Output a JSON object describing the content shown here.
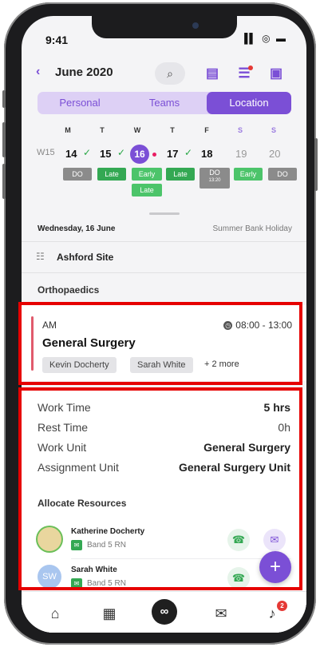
{
  "status_bar": {
    "time": "9:41",
    "icons": "▐▌ ◎ ▬"
  },
  "header": {
    "back_icon": "‹",
    "month": "June 2020",
    "search_icon": "⌕",
    "layout_icon": "▤",
    "filter_icon": "☰",
    "calendar_icon": "▣"
  },
  "segments": [
    "Personal",
    "Teams",
    "Location"
  ],
  "week": {
    "label": "W15",
    "day_letters": [
      "M",
      "T",
      "W",
      "T",
      "F",
      "S",
      "S"
    ],
    "days": [
      {
        "num": "14",
        "check": "✓",
        "shifts": [
          "DO"
        ]
      },
      {
        "num": "15",
        "check": "✓",
        "shifts": [
          "Late"
        ]
      },
      {
        "num": "16",
        "check": "",
        "shifts": [
          "Early",
          "Late"
        ]
      },
      {
        "num": "17",
        "check": "✓",
        "shifts": [
          "Late"
        ]
      },
      {
        "num": "18",
        "check": "",
        "shifts": [
          "DO",
          "13:20"
        ]
      },
      {
        "num": "19",
        "check": "",
        "shifts": [
          "Early"
        ]
      },
      {
        "num": "20",
        "check": "",
        "shifts": [
          "DO"
        ]
      }
    ]
  },
  "sheet": {
    "date": "Wednesday, 16 June",
    "holiday": "Summer Bank Holiday",
    "site_icon": "☷",
    "site": "Ashford Site",
    "department": "Orthopaedics"
  },
  "shift_card": {
    "period": "AM",
    "clock_icon": "◷",
    "time": "08:00 - 13:00",
    "title": "General Surgery",
    "people": [
      "Kevin Docherty",
      "Sarah White"
    ],
    "more": "+ 2 more"
  },
  "details": [
    {
      "label": "Work Time",
      "value": "5 hrs"
    },
    {
      "label": "Rest Time",
      "value": "0h"
    },
    {
      "label": "Work Unit",
      "value": "General Surgery"
    },
    {
      "label": "Assignment Unit",
      "value": "General Surgery Unit"
    }
  ],
  "allocate": {
    "title": "Allocate Resources",
    "resources": [
      {
        "name": "Katherine Docherty",
        "band": "Band 5 RN",
        "initials": ""
      },
      {
        "name": "Sarah White",
        "band": "Band 5 RN",
        "initials": "SW"
      }
    ]
  },
  "fab": "+",
  "tabbar": {
    "home_icon": "⌂",
    "calendar_icon": "▦",
    "center_icon": "∞",
    "chat_icon": "✉",
    "bell_icon": "♪",
    "badge": "2"
  },
  "colors": {
    "accent": "#7b4fd6",
    "highlight": "#e60000",
    "green": "#34a853"
  }
}
